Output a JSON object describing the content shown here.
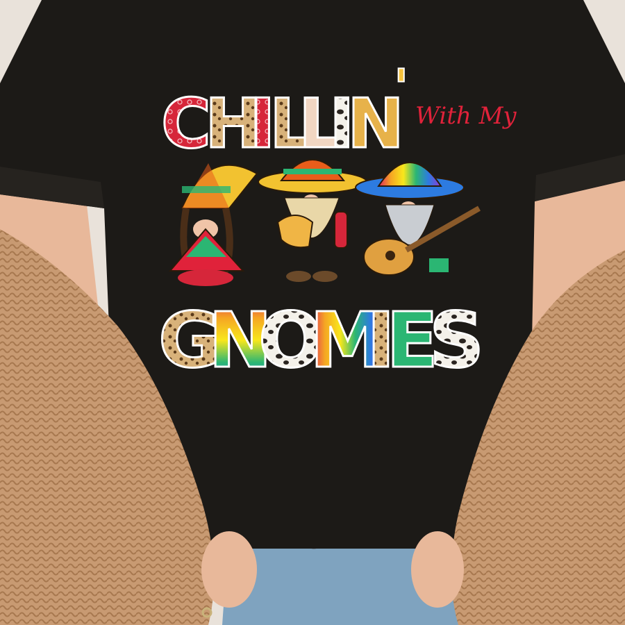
{
  "photo": {
    "colors": {
      "shirt": "#1c1a17",
      "sweater": "#c89a72",
      "sweater_dark": "#a7784f",
      "skin": "#e8b89a",
      "jeans": "#7fa3bf",
      "background": "#e9e2da",
      "accent_red": "#d6263a"
    }
  },
  "print": {
    "line1": "CHILLIN'",
    "script": "With My",
    "line2": "GNOMIES",
    "line1_letters": [
      "C",
      "H",
      "I",
      "L",
      "L",
      "I",
      "N",
      "'"
    ],
    "line2_letters": [
      "G",
      "N",
      "O",
      "M",
      "I",
      "E",
      "S"
    ]
  },
  "gnomes": [
    {
      "id": "girl-gnome",
      "hat": "striped pointed hat",
      "item": "braids and poncho"
    },
    {
      "id": "taco-gnome",
      "hat": "sombrero",
      "item": "taco and hot sauce"
    },
    {
      "id": "guitar-gnome",
      "hat": "sombrero",
      "item": "guitar"
    }
  ]
}
